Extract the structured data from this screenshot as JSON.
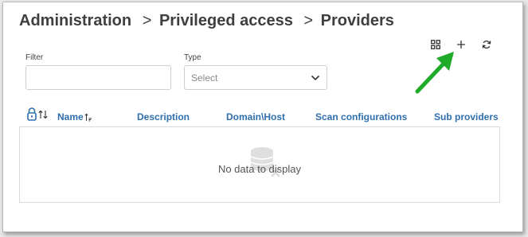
{
  "breadcrumb": {
    "items": [
      "Administration",
      "Privileged access",
      "Providers"
    ],
    "separator": ">"
  },
  "toolbar": {
    "icons": [
      "grid-view-icon",
      "add-icon",
      "refresh-icon"
    ]
  },
  "filters": {
    "filter_label": "Filter",
    "filter_value": "",
    "type_label": "Type",
    "type_placeholder": "Select"
  },
  "grid": {
    "columns": [
      "Name",
      "Description",
      "Domain\\Host",
      "Scan configurations",
      "Sub providers"
    ],
    "empty_message": "No data to display"
  },
  "colors": {
    "accent": "#2f6fae",
    "annotation_arrow": "#1faa2a",
    "text": "#3f3f3f"
  }
}
